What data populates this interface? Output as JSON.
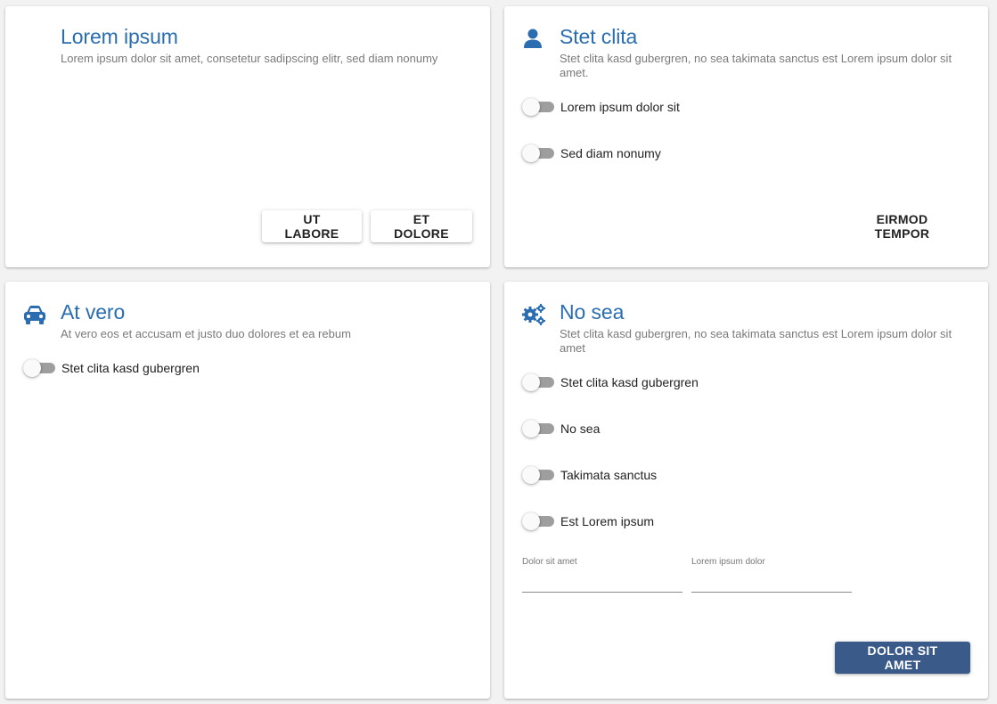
{
  "cards": [
    {
      "title": "Lorem ipsum",
      "subtitle": "Lorem ipsum dolor sit amet, consetetur sadipscing elitr, sed diam nonumy",
      "buttons": [
        "UT LABORE",
        "ET DOLORE"
      ]
    },
    {
      "icon": "user-icon",
      "title": "Stet clita",
      "subtitle": "Stet clita kasd gubergren, no sea takimata sanctus est Lorem ipsum dolor sit amet.",
      "toggles": [
        "Lorem ipsum dolor sit",
        "Sed diam nonumy"
      ],
      "button": "EIRMOD TEMPOR"
    },
    {
      "icon": "car-icon",
      "title": "At vero",
      "subtitle": "At vero eos et accusam et justo duo dolores et ea rebum",
      "toggles": [
        "Stet clita kasd gubergren"
      ]
    },
    {
      "icon": "cogs-icon",
      "title": "No sea",
      "subtitle": "Stet clita kasd gubergren, no sea takimata sanctus est Lorem ipsum dolor sit amet",
      "toggles": [
        "Stet clita kasd gubergren",
        "No sea",
        "Takimata sanctus",
        "Est Lorem ipsum"
      ],
      "fields": [
        {
          "label": "Dolor sit amet",
          "value": ""
        },
        {
          "label": "Lorem ipsum dolor",
          "value": ""
        }
      ],
      "button": "DOLOR SIT AMET"
    }
  ],
  "colors": {
    "title": "#2a6db0",
    "icon": "#2a6db0",
    "primary_button": "#3a5a8a",
    "toggle_track": "#9e9e9e"
  }
}
